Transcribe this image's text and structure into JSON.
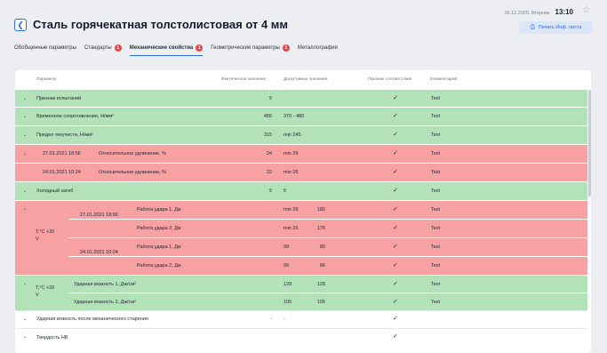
{
  "header": {
    "title": "Сталь горячекатная толстолистовая от 4 мм",
    "date": "16.12.2020, Вторник",
    "time": "13:10",
    "print_label": "Печать Инф. листа"
  },
  "tabs": [
    {
      "label": "Обобщенные параметры",
      "badge": ""
    },
    {
      "label": "Стандарты",
      "badge": "1"
    },
    {
      "label": "Механические свойства",
      "badge": "1"
    },
    {
      "label": "Геометрические параметры",
      "badge": "1"
    },
    {
      "label": "Металлография",
      "badge": ""
    }
  ],
  "columns": {
    "param": "Параметр",
    "actual": "Фактическое значение",
    "allowed": "Допустимые значения",
    "compliance": "Признак соответствия",
    "comment": "Комментарий"
  },
  "rows": [
    {
      "param": "Признак испытаний",
      "actual": "5",
      "allowed": "",
      "comment": "Text"
    },
    {
      "param": "Временное сопротивление, Н/мм²",
      "actual": "455",
      "allowed": "370 - 480",
      "comment": "Text"
    },
    {
      "param": "Предел текучести, Н/мм²",
      "actual": "315",
      "allowed": "min 245",
      "comment": "Text"
    },
    {
      "date": "27.01.2021 18:56",
      "param": "Относительное удлинение, %",
      "actual": "24",
      "allowed": "min 26",
      "comment": "Text"
    },
    {
      "date": "24.01.2021 10:24",
      "param": "Относительное удлинение, %",
      "actual": "22",
      "allowed": "min 26",
      "comment": "Text"
    },
    {
      "param": "Холодный загиб",
      "actual": "5",
      "allowed": "5",
      "comment": "Text"
    },
    {
      "group": "T,°C +20",
      "unit": "V",
      "date": "27.01.2021 18:56",
      "param": "Работа удара 1, Дж",
      "actual": "180",
      "allowed": "min 26",
      "comment": "Text"
    },
    {
      "param": "Работа удара 2, Дж",
      "actual": "176",
      "allowed": "min 26",
      "comment": "Text"
    },
    {
      "date": "24.01.2021 10:24",
      "param": "Работа удара 1, Дж",
      "actual": "80",
      "allowed": "99",
      "comment": "Text"
    },
    {
      "param": "Работа удара 2, Дж",
      "actual": "86",
      "allowed": "99",
      "comment": "Text"
    },
    {
      "group": "T,°C +20",
      "unit": "V",
      "param": "Ударная вязкость 1, Дж/см²",
      "actual": "128",
      "allowed": "128",
      "comment": "Text"
    },
    {
      "param": "Ударная вязкость 2, Дж/см²",
      "actual": "105",
      "allowed": "105",
      "comment": "Text"
    },
    {
      "param": "Ударная вязкость после механического старения",
      "actual": "-",
      "allowed": "-",
      "comment": ""
    },
    {
      "param": "Твердость HB",
      "actual": "",
      "allowed": "",
      "comment": ""
    }
  ],
  "icons": {
    "back": "chevron-left-icon",
    "star": "star-icon",
    "print": "printer-icon",
    "expand": "chevron-down-icon",
    "check": "checkmark-icon"
  },
  "colors": {
    "accent": "#2e6be6",
    "ok_row": "#b4e2b8",
    "fail_row": "#f7a1a3",
    "badge": "#e44848"
  }
}
